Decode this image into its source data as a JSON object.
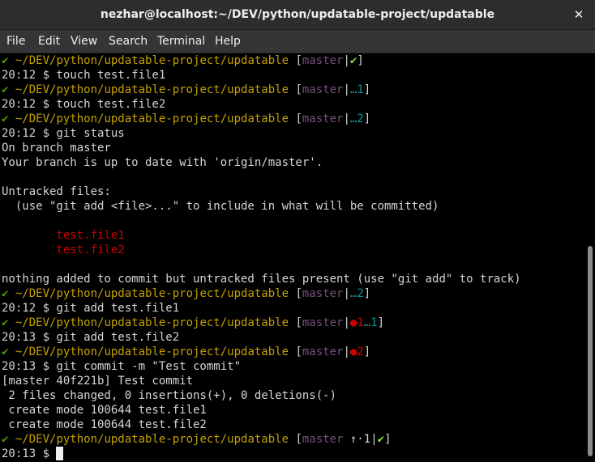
{
  "window": {
    "title": "nezhar@localhost:~/DEV/python/updatable-project/updatable",
    "close_glyph": "✕"
  },
  "menu": [
    "File",
    "Edit",
    "View",
    "Search",
    "Terminal",
    "Help"
  ],
  "prompt": {
    "check": "✔",
    "path": "~/DEV/python/updatable-project/updatable",
    "branch": "master",
    "open": "[",
    "close": "]",
    "sep": "|"
  },
  "lines": {
    "l1_status": "✔",
    "l2": "20:12 $ touch test.file1",
    "l3_status": "…1",
    "l4": "20:12 $ touch test.file2",
    "l5_status": "…2",
    "l6": "20:12 $ git status",
    "l7": "On branch master",
    "l8": "Your branch is up to date with 'origin/master'.",
    "l10": "Untracked files:",
    "l11": "  (use \"git add <file>...\" to include in what will be committed)",
    "l13": "        test.file1",
    "l14": "        test.file2",
    "l16": "nothing added to commit but untracked files present (use \"git add\" to track)",
    "l17_status": "…2",
    "l18": "20:12 $ git add test.file1",
    "l19_staged": "●1",
    "l19_untracked": "…1",
    "l20": "20:13 $ git add test.file2",
    "l21_staged": "●2",
    "l22": "20:13 $ git commit -m \"Test commit\"",
    "l23": "[master 40f221b] Test commit",
    "l24": " 2 files changed, 0 insertions(+), 0 deletions(-)",
    "l25": " create mode 100644 test.file1",
    "l26": " create mode 100644 test.file2",
    "l27_ahead": " ↑·1",
    "l27_status": "✔",
    "l28": "20:13 $ "
  }
}
